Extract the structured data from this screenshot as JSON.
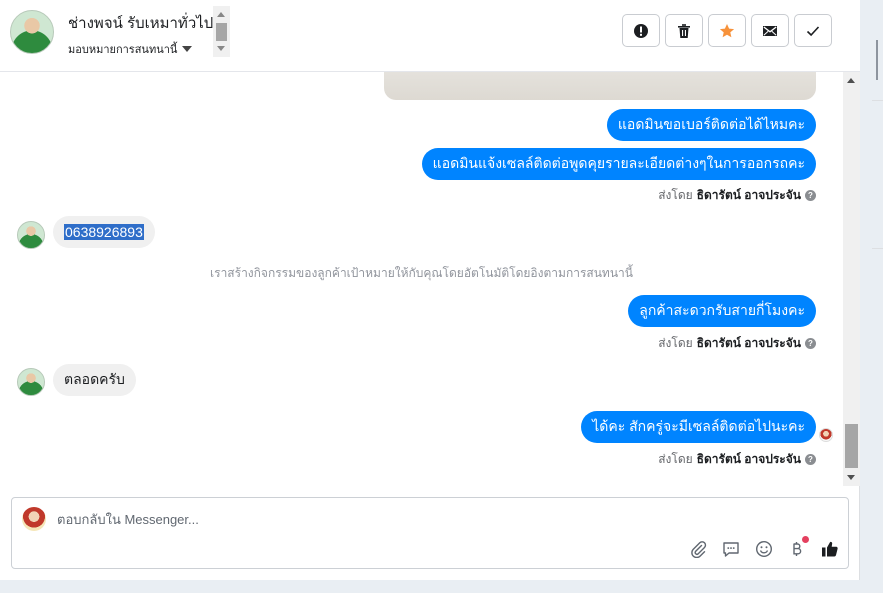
{
  "header": {
    "contact_name": "ช่างพจน์ รับเหมาทั่วไป",
    "assign_label": "มอบหมายการสนทนานี้",
    "actions": [
      {
        "name": "report-button",
        "icon": "exclamation-circle-icon"
      },
      {
        "name": "delete-button",
        "icon": "trash-icon"
      },
      {
        "name": "star-button",
        "icon": "star-icon",
        "color": "#f7923b"
      },
      {
        "name": "mark-unread-button",
        "icon": "envelope-icon"
      },
      {
        "name": "mark-done-button",
        "icon": "checkmark-icon"
      }
    ]
  },
  "chat": {
    "messages": [
      {
        "direction": "out",
        "text": "แอดมินขอเบอร์ติดต่อได้ไหมคะ"
      },
      {
        "direction": "out",
        "text": "แอดมินแจ้งเซลล์ติดต่อพูดคุยรายละเอียดต่างๆในการออกรถคะ"
      },
      {
        "direction": "in",
        "text": "0638926893"
      },
      {
        "direction": "out",
        "text": "ลูกค้าสะดวกรับสายกี่โมงคะ"
      },
      {
        "direction": "in",
        "text": "ตลอดครับ"
      },
      {
        "direction": "out",
        "text": "ได้คะ สักครู่จะมีเซลล์ติดต่อไปนะคะ"
      }
    ],
    "sent_by_prefix": "ส่งโดย",
    "sent_by_name": "ธิดารัตน์ อาจประจัน",
    "help_glyph": "?",
    "system_note": "เราสร้างกิจกรรมของลูกค้าเป้าหมายให้กับคุณโดยอัตโนมัติโดยอิงตามการสนทนานี้"
  },
  "composer": {
    "placeholder": "ตอบกลับใน Messenger...",
    "tools": [
      "paperclip-icon",
      "saved-reply-icon",
      "emoji-icon",
      "baht-payment-icon",
      "thumbs-up-icon"
    ]
  },
  "colors": {
    "accent": "#0084ff",
    "incoming_bubble": "#f0f0f0",
    "star": "#f7923b",
    "highlight": "#2f6ec9"
  }
}
